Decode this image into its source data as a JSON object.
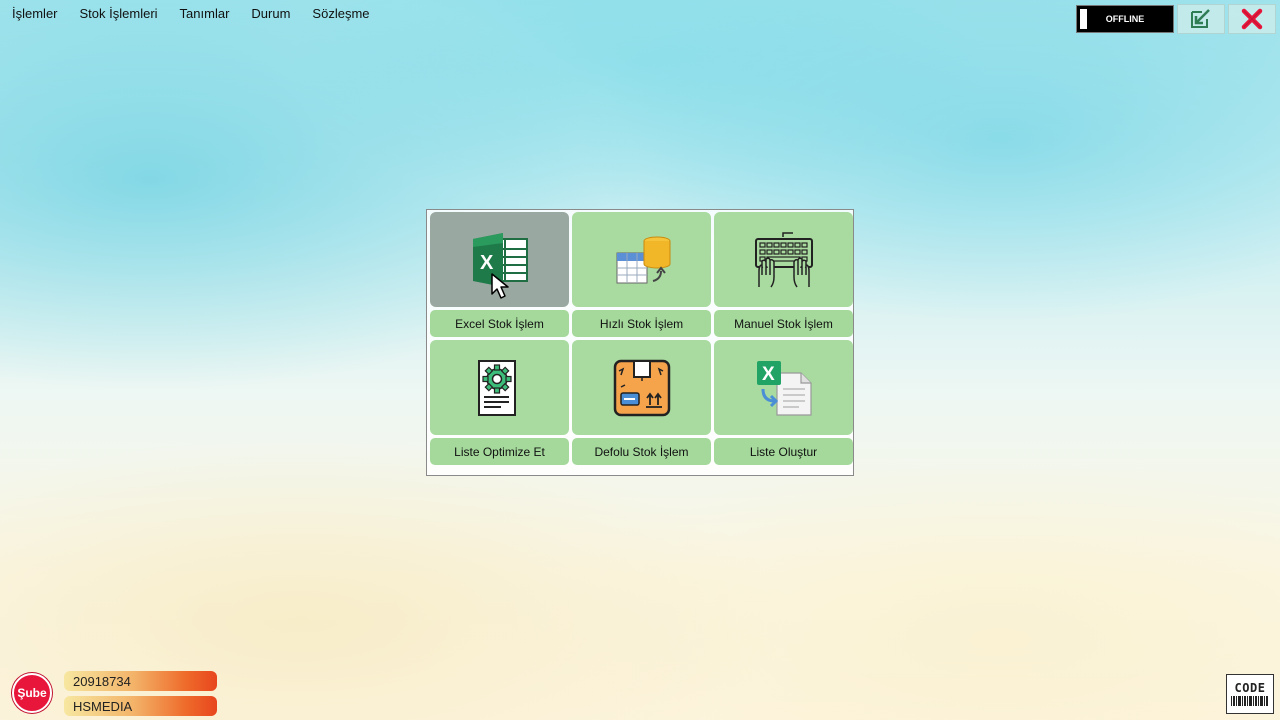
{
  "menu": [
    "İşlemler",
    "Stok İşlemleri",
    "Tanımlar",
    "Durum",
    "Sözleşme"
  ],
  "status": {
    "label": "OFFLINE"
  },
  "icons": {
    "minimize": "arrow-down-left-icon",
    "close": "close-icon"
  },
  "tiles": [
    {
      "label": "Excel Stok İşlem",
      "icon": "excel-icon",
      "active": true
    },
    {
      "label": "Hızlı Stok İşlem",
      "icon": "database-table-icon",
      "active": false
    },
    {
      "label": "Manuel Stok İşlem",
      "icon": "keyboard-hands-icon",
      "active": false
    },
    {
      "label": "Liste Optimize Et",
      "icon": "document-gear-icon",
      "active": false
    },
    {
      "label": "Defolu Stok İşlem",
      "icon": "damaged-box-icon",
      "active": false
    },
    {
      "label": "Liste Oluştur",
      "icon": "excel-export-icon",
      "active": false
    }
  ],
  "branch": {
    "badge": "Şube",
    "code": "20918734",
    "name": "HSMEDIA"
  },
  "logo": {
    "text": "CODE"
  },
  "colors": {
    "tile": "#a9dba0",
    "tile_active": "#99a8a0",
    "close": "#e8163b",
    "accent_green": "#2e7d55"
  }
}
